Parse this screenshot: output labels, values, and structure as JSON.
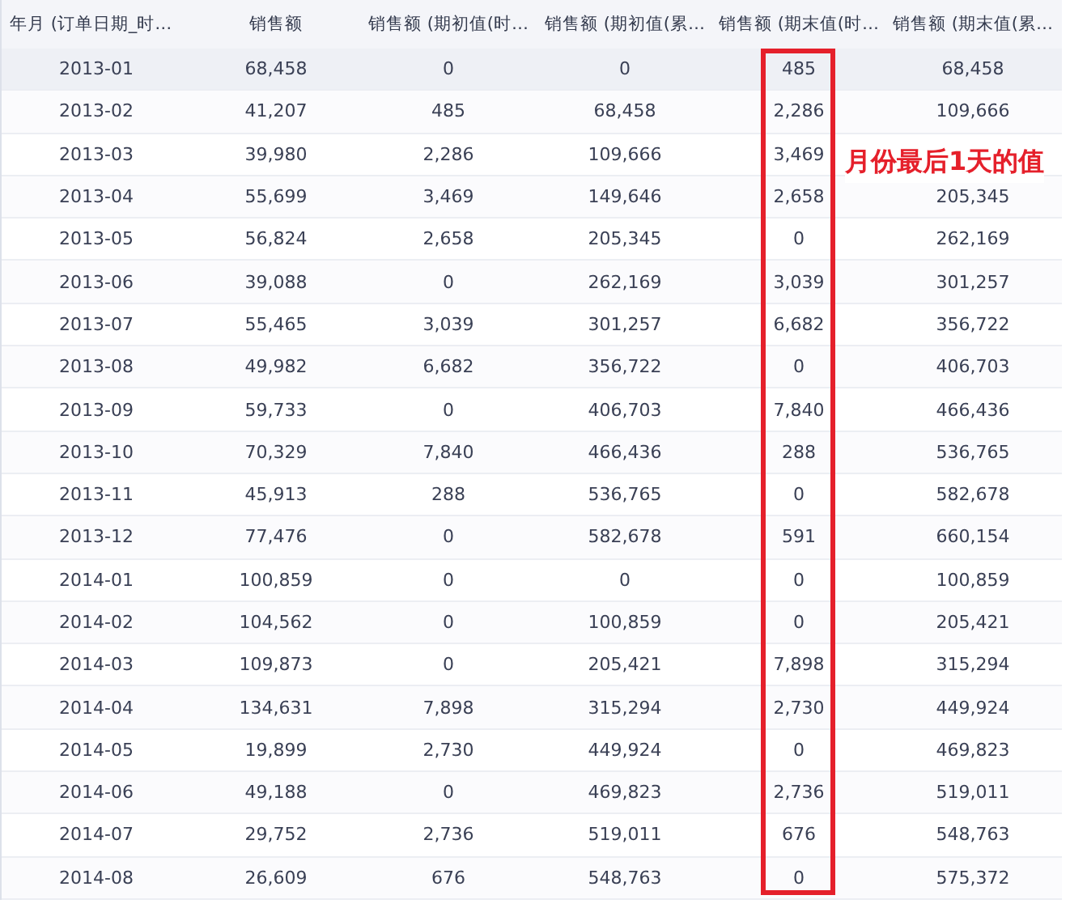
{
  "table": {
    "columns": [
      {
        "label": "年月 (订单日期_时…",
        "highlighted": false
      },
      {
        "label": "销售额",
        "highlighted": false
      },
      {
        "label": "销售额 (期初值(时…",
        "highlighted": false
      },
      {
        "label": "销售额 (期初值(累…",
        "highlighted": false
      },
      {
        "label": "销售额 (期末值(时…",
        "highlighted": true
      },
      {
        "label": "销售额 (期末值(累…",
        "highlighted": false
      }
    ],
    "rows": [
      {
        "cells": [
          "2013-01",
          "68,458",
          "0",
          "0",
          "485",
          "68,458"
        ],
        "selected": true
      },
      {
        "cells": [
          "2013-02",
          "41,207",
          "485",
          "68,458",
          "2,286",
          "109,666"
        ],
        "selected": false
      },
      {
        "cells": [
          "2013-03",
          "39,980",
          "2,286",
          "109,666",
          "3,469",
          null
        ],
        "selected": false
      },
      {
        "cells": [
          "2013-04",
          "55,699",
          "3,469",
          "149,646",
          "2,658",
          "205,345"
        ],
        "selected": false
      },
      {
        "cells": [
          "2013-05",
          "56,824",
          "2,658",
          "205,345",
          "0",
          "262,169"
        ],
        "selected": false
      },
      {
        "cells": [
          "2013-06",
          "39,088",
          "0",
          "262,169",
          "3,039",
          "301,257"
        ],
        "selected": false
      },
      {
        "cells": [
          "2013-07",
          "55,465",
          "3,039",
          "301,257",
          "6,682",
          "356,722"
        ],
        "selected": false
      },
      {
        "cells": [
          "2013-08",
          "49,982",
          "6,682",
          "356,722",
          "0",
          "406,703"
        ],
        "selected": false
      },
      {
        "cells": [
          "2013-09",
          "59,733",
          "0",
          "406,703",
          "7,840",
          "466,436"
        ],
        "selected": false
      },
      {
        "cells": [
          "2013-10",
          "70,329",
          "7,840",
          "466,436",
          "288",
          "536,765"
        ],
        "selected": false
      },
      {
        "cells": [
          "2013-11",
          "45,913",
          "288",
          "536,765",
          "0",
          "582,678"
        ],
        "selected": false
      },
      {
        "cells": [
          "2013-12",
          "77,476",
          "0",
          "582,678",
          "591",
          "660,154"
        ],
        "selected": false
      },
      {
        "cells": [
          "2014-01",
          "100,859",
          "0",
          "0",
          "0",
          "100,859"
        ],
        "selected": false
      },
      {
        "cells": [
          "2014-02",
          "104,562",
          "0",
          "100,859",
          "0",
          "205,421"
        ],
        "selected": false
      },
      {
        "cells": [
          "2014-03",
          "109,873",
          "0",
          "205,421",
          "7,898",
          "315,294"
        ],
        "selected": false
      },
      {
        "cells": [
          "2014-04",
          "134,631",
          "7,898",
          "315,294",
          "2,730",
          "449,924"
        ],
        "selected": false
      },
      {
        "cells": [
          "2014-05",
          "19,899",
          "2,730",
          "449,924",
          "0",
          "469,823"
        ],
        "selected": false
      },
      {
        "cells": [
          "2014-06",
          "49,188",
          "0",
          "469,823",
          "2,736",
          "519,011"
        ],
        "selected": false
      },
      {
        "cells": [
          "2014-07",
          "29,752",
          "2,736",
          "519,011",
          "676",
          "548,763"
        ],
        "selected": false
      },
      {
        "cells": [
          "2014-08",
          "26,609",
          "676",
          "548,763",
          "0",
          "575,372"
        ],
        "selected": false
      }
    ]
  },
  "annotation": {
    "text": "月份最后1天的值"
  }
}
